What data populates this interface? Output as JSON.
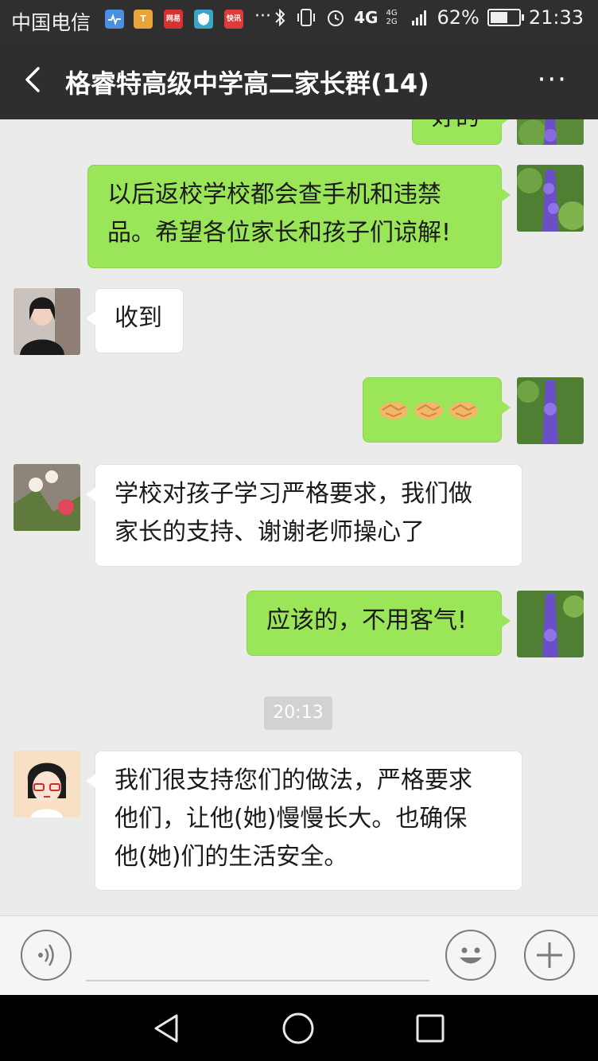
{
  "status_bar": {
    "carrier": "中国电信",
    "notifications": [
      {
        "icon": "health-app-icon",
        "label": "",
        "color": "#4a8fe0"
      },
      {
        "icon": "bookmark-app-icon",
        "label": "T",
        "color": "#e8a33a"
      },
      {
        "icon": "netease-app-icon",
        "label": "网易",
        "color": "#d9322e"
      },
      {
        "icon": "security-app-icon",
        "label": "",
        "color": "#3aa7c9"
      },
      {
        "icon": "news-app-icon",
        "label": "快讯",
        "color": "#e03a3a"
      }
    ],
    "more": "···",
    "network": "4G",
    "network2": "4G 2G",
    "battery": "62%",
    "battery_level": 0.62,
    "time": "21:33"
  },
  "header": {
    "title": "格睿特高级中学高二家长群(14)",
    "more": "···"
  },
  "messages": [
    {
      "side": "me",
      "text": "好的"
    },
    {
      "side": "me",
      "text": "以后返校学校都会查手机和违禁品。希望各位家长和孩子们谅解!",
      "lines": [
        "以后返校学校都会查手机和违禁",
        "品。希望各位家长和孩子们谅解!"
      ]
    },
    {
      "side": "other",
      "text": "收到"
    },
    {
      "side": "me",
      "emoji": "handshake",
      "count": 3
    },
    {
      "side": "other",
      "text": "学校对孩子学习严格要求，我们做家长的支持、谢谢老师操心了",
      "lines": [
        "学校对孩子学习严格要求，我们做",
        "家长的支持、谢谢老师操心了"
      ]
    },
    {
      "side": "me",
      "text": "应该的，不用客气!"
    },
    {
      "side": "other",
      "text": "我们很支持您们的做法，严格要求他们，让他(她)慢慢长大。也确保他(她)们的生活安全。",
      "lines": [
        "我们很支持您们的做法，严格要求",
        "他们，让他(她)慢慢长大。也确保",
        "他(她)们的生活安全。"
      ]
    }
  ],
  "timestamp": "20:13",
  "colors": {
    "my_bubble": "#9ae658",
    "other_bubble": "#ffffff",
    "header_bg": "#2e2e2e",
    "chat_bg": "#ebebeb"
  }
}
